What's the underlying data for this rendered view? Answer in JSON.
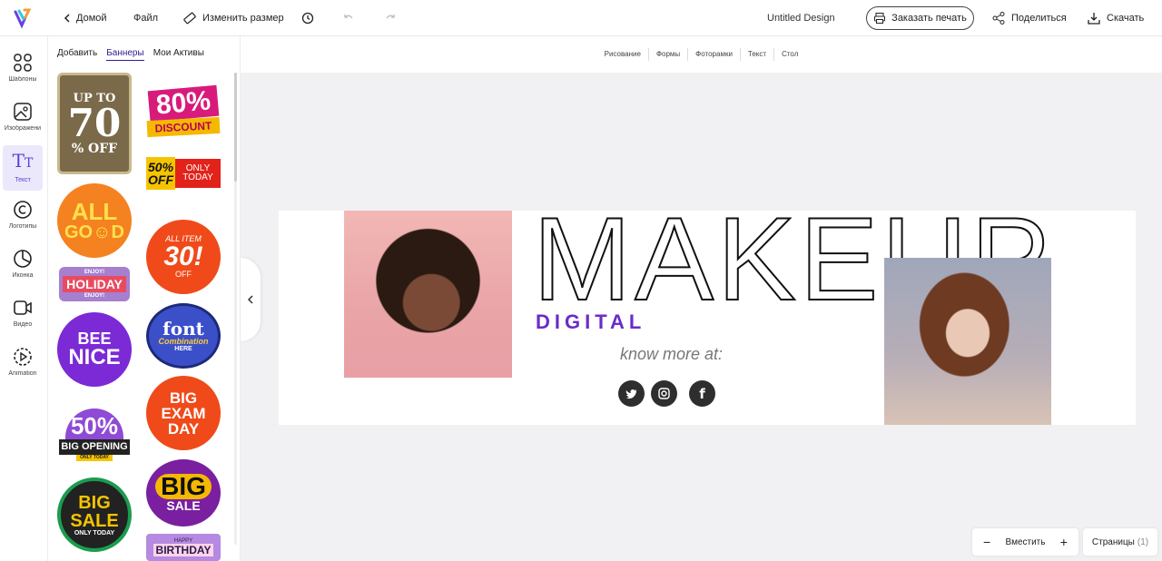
{
  "topbar": {
    "home_label": "Домой",
    "file_label": "Файл",
    "resize_label": "Изменить размер",
    "design_title": "Untitled Design",
    "print_label": "Заказать печать",
    "share_label": "Поделиться",
    "download_label": "Скачать"
  },
  "rail": {
    "items": [
      {
        "label": "Шаблоны",
        "icon": "templates-icon"
      },
      {
        "label": "Изображени",
        "icon": "image-icon"
      },
      {
        "label": "Текст",
        "icon": "text-icon"
      },
      {
        "label": "Логотипы",
        "icon": "copyright-icon"
      },
      {
        "label": "Иконка",
        "icon": "pie-icon"
      },
      {
        "label": "Видео",
        "icon": "video-icon"
      },
      {
        "label": "Animation",
        "icon": "play-circle-icon"
      }
    ]
  },
  "panel": {
    "tabs": [
      "Добавить",
      "Баннеры",
      "Мои Активы"
    ],
    "active_tab": "Баннеры",
    "stickers": [
      {
        "line1": "UP TO",
        "line2": "70",
        "line3": "% OFF"
      },
      {
        "line1": "80%",
        "line2": "DISCOUNT"
      },
      {
        "line1": "50%",
        "line2": "OFF",
        "line3": "ONLY TODAY"
      },
      {
        "line1": "ALL",
        "line2": "GO☺D"
      },
      {
        "line1": "ALL ITEM",
        "line2": "30!",
        "line3": "OFF"
      },
      {
        "line1": "ENJOY!",
        "line2": "HOLIDAY",
        "line3": "ENJOY!"
      },
      {
        "line1": "BEE",
        "line2": "NICE"
      },
      {
        "line1": "font",
        "line2": "Combination",
        "line3": "HERE"
      },
      {
        "line1": "50%",
        "line2": "BIG OPENING",
        "line3": "ONLY TODAY"
      },
      {
        "line1": "BIG",
        "line2": "EXAM",
        "line3": "DAY"
      },
      {
        "line1": "BIG",
        "line2": "SALE",
        "line3": "ONLY TODAY"
      },
      {
        "line1": "BIG",
        "line2": "SALE"
      },
      {
        "line1": "HAPPY",
        "line2": "BIRTHDAY"
      }
    ]
  },
  "subtoolbar": [
    "Рисование",
    "Формы",
    "Фоторамки",
    "Текст",
    "Стол"
  ],
  "canvas": {
    "headline": "MAKEUP",
    "subheadline": "DIGITAL",
    "tagline": "know more at:",
    "social": [
      "twitter",
      "instagram",
      "facebook"
    ]
  },
  "zoom": {
    "label": "Вместить",
    "minus": "−",
    "plus": "+"
  },
  "pages": {
    "label": "Страницы",
    "count": "(1)"
  },
  "colors": {
    "accent": "#5b3fd8",
    "digital_text": "#6a2cc8"
  }
}
